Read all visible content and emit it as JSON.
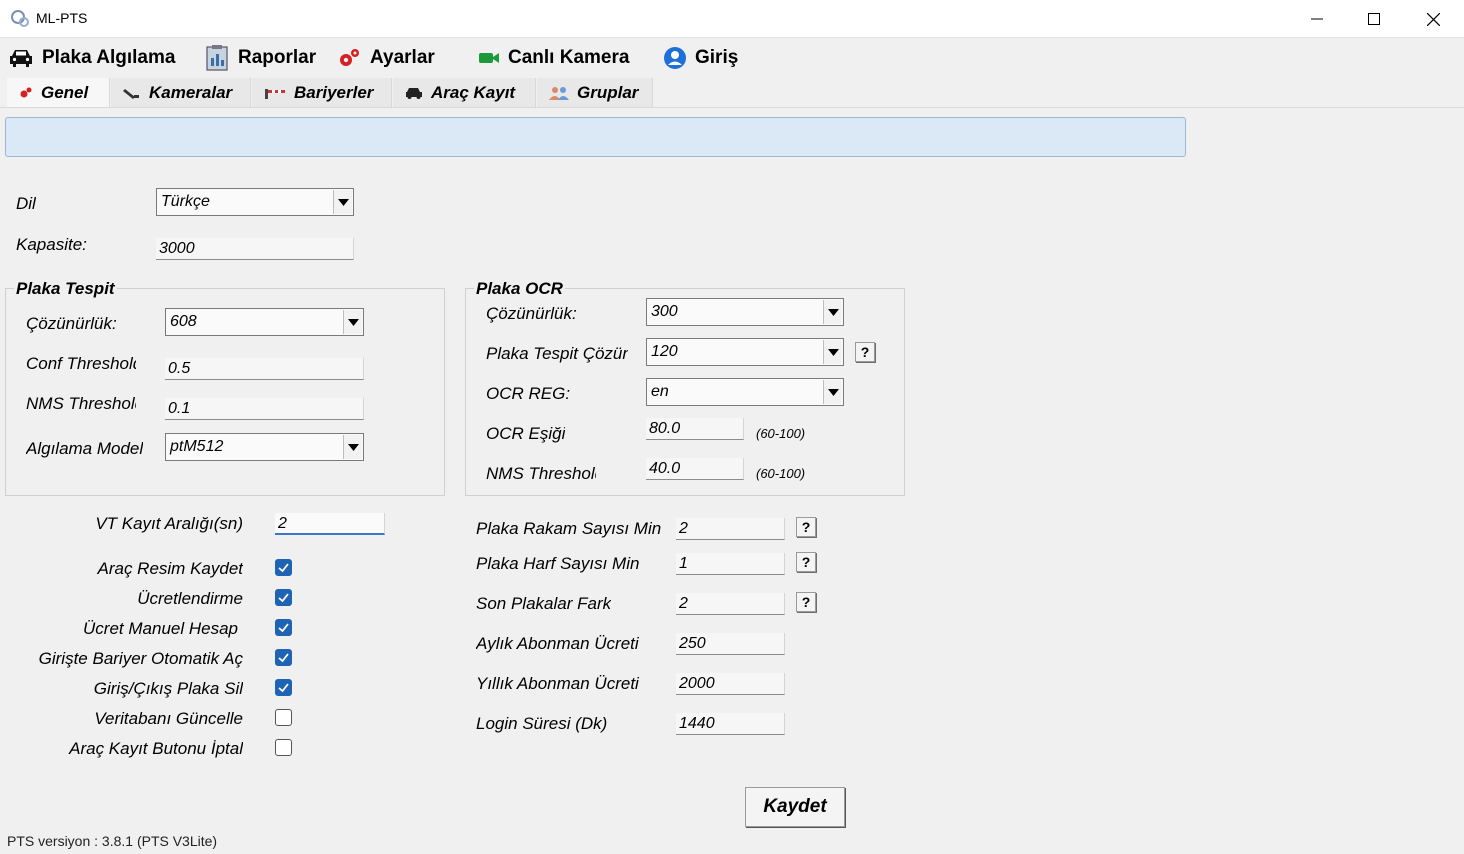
{
  "window": {
    "title": "ML-PTS"
  },
  "main_tabs": [
    {
      "label": "Plaka Algılama",
      "icon": "car-icon"
    },
    {
      "label": "Raporlar",
      "icon": "report-icon"
    },
    {
      "label": "Ayarlar",
      "icon": "gears-icon"
    },
    {
      "label": "Canlı Kamera",
      "icon": "video-camera-icon"
    },
    {
      "label": "Giriş",
      "icon": "user-icon"
    }
  ],
  "sub_tabs": [
    {
      "label": "Genel",
      "icon": "gears-icon"
    },
    {
      "label": "Kameralar",
      "icon": "camera-icon"
    },
    {
      "label": "Bariyerler",
      "icon": "barrier-icon"
    },
    {
      "label": "Araç Kayıt",
      "icon": "car-register-icon"
    },
    {
      "label": "Gruplar",
      "icon": "group-icon"
    }
  ],
  "general": {
    "language_label": "Dil",
    "language_value": "Türkçe",
    "capacity_label": "Kapasite:",
    "capacity_value": "3000"
  },
  "plate_detect": {
    "title": "Plaka Tespit",
    "resolution_label": "Çözünürlük:",
    "resolution_value": "608",
    "conf_label": "Conf Threshold",
    "conf_value": "0.5",
    "nms_label": "NMS Threshold",
    "nms_value": "0.1",
    "model_label": "Algılama Model",
    "model_value": "ptM512"
  },
  "plate_ocr": {
    "title": "Plaka OCR",
    "resolution_label": "Çözünürlük:",
    "resolution_value": "300",
    "detect_res_label": "Plaka Tespit Çözün",
    "detect_res_value": "120",
    "reg_label": "OCR REG:",
    "reg_value": "en",
    "threshold_label": "OCR Eşiği",
    "threshold_value": "80.0",
    "threshold_range": "(60-100)",
    "nms_label": "NMS Threshold",
    "nms_value": "40.0",
    "nms_range": "(60-100)",
    "help_label": "?"
  },
  "options": {
    "db_interval_label": "VT Kayıt Aralığı(sn)",
    "db_interval_value": "2",
    "checkboxes": [
      {
        "label": "Araç Resim Kaydet",
        "checked": true
      },
      {
        "label": "Ücretlendirme",
        "checked": true
      },
      {
        "label": "Ücret Manuel Hesap",
        "checked": true
      },
      {
        "label": "Girişte Bariyer Otomatik Aç",
        "checked": true
      },
      {
        "label": "Giriş/Çıkış Plaka Sil",
        "checked": true
      },
      {
        "label": "Veritabanı Güncelle",
        "checked": false
      },
      {
        "label": "Araç Kayıt Butonu İptal",
        "checked": false
      }
    ]
  },
  "right_fields": [
    {
      "label": "Plaka Rakam Sayısı Min",
      "value": "2",
      "help": "?"
    },
    {
      "label": "Plaka Harf Sayısı Min",
      "value": "1",
      "help": "?"
    },
    {
      "label": "Son Plakalar Fark",
      "value": "2",
      "help": "?"
    },
    {
      "label": "Aylık Abonman Ücreti",
      "value": "250"
    },
    {
      "label": "Yıllık Abonman Ücreti",
      "value": "2000"
    },
    {
      "label": "Login Süresi (Dk)",
      "value": "1440"
    }
  ],
  "save_label": "Kaydet",
  "version_text": "PTS versiyon : 3.8.1 (PTS V3Lite)",
  "colors": {
    "checkbox_on": "#1f63b4",
    "info_bar": "#dbe8f5",
    "background": "#f0f0f0"
  }
}
